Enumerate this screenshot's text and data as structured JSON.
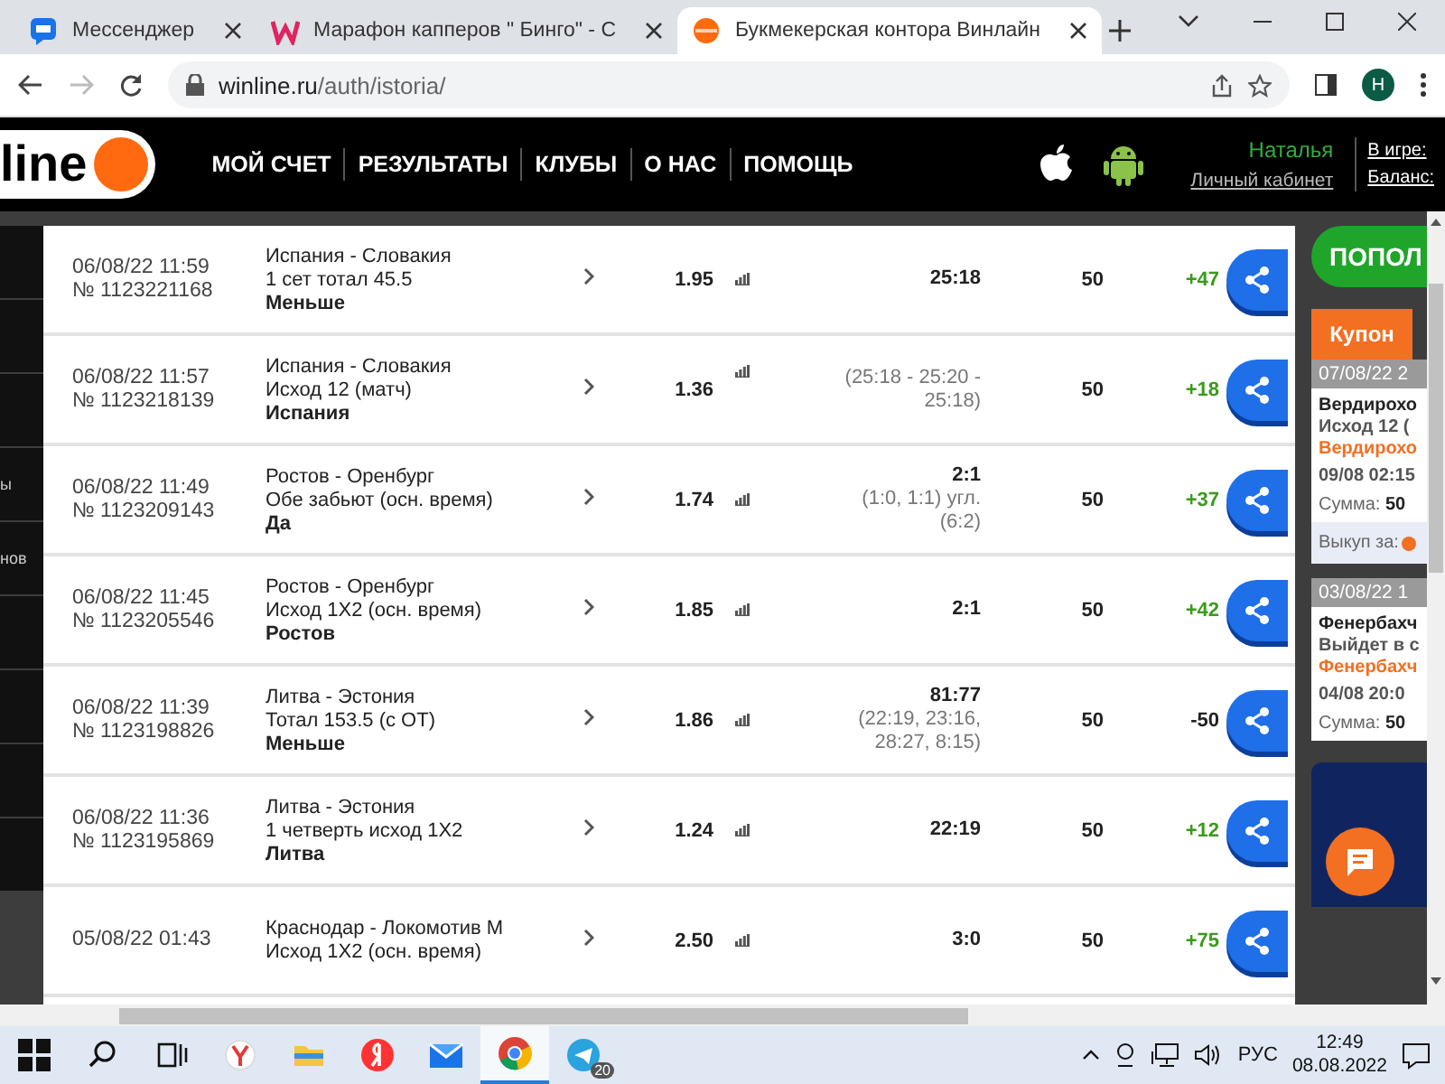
{
  "browser": {
    "tabs": [
      {
        "title": "Мессенджер",
        "selected": false
      },
      {
        "title": "Марафон капперов \" Бинго\" - С",
        "selected": false
      },
      {
        "title": "Букмекерская контора Винлайн",
        "selected": true
      }
    ],
    "url_host": "winline.ru",
    "url_path": "/auth/istoria/",
    "profile": "Н"
  },
  "header": {
    "logo": "line",
    "nav": [
      "МОЙ СЧЕТ",
      "РЕЗУЛЬТАТЫ",
      "КЛУБЫ",
      "О НАС",
      "ПОМОЩЬ"
    ],
    "user": "Наталья",
    "cabinet": "Личный кабинет",
    "in_game": "В игре:",
    "balance": "Баланс:"
  },
  "sidebar": {
    "items": [
      "ы",
      "нов"
    ]
  },
  "bets": [
    {
      "datetime": "06/08/22 11:59",
      "number": "№ 1123221168",
      "match": "Испания - Словакия",
      "market": "1 сет тотал 45.5",
      "pick": "Меньше",
      "odds": "1.95",
      "score": "25:18",
      "stake": "50",
      "result": "+47",
      "won": true
    },
    {
      "datetime": "06/08/22 11:57",
      "number": "№ 1123218139",
      "match": "Испания - Словакия",
      "market": "Исход 12 (матч)",
      "pick": "Испания",
      "odds": "1.36",
      "score_detail": "(25:18 - 25:20 - 25:18)",
      "stake": "50",
      "result": "+18",
      "won": true
    },
    {
      "datetime": "06/08/22 11:49",
      "number": "№ 1123209143",
      "match": "Ростов - Оренбург",
      "market": "Обе забьют (осн. время)",
      "pick": "Да",
      "odds": "1.74",
      "score": "2:1",
      "score_detail": "(1:0, 1:1) угл. (6:2)",
      "stake": "50",
      "result": "+37",
      "won": true
    },
    {
      "datetime": "06/08/22 11:45",
      "number": "№ 1123205546",
      "match": "Ростов - Оренбург",
      "market": "Исход 1Х2 (осн. время)",
      "pick": "Ростов",
      "odds": "1.85",
      "score": "2:1",
      "stake": "50",
      "result": "+42",
      "won": true
    },
    {
      "datetime": "06/08/22 11:39",
      "number": "№ 1123198826",
      "match": "Литва - Эстония",
      "market": "Тотал 153.5 (с ОТ)",
      "pick": "Меньше",
      "odds": "1.86",
      "score": "81:77",
      "score_detail": "(22:19, 23:16, 28:27, 8:15)",
      "stake": "50",
      "result": "-50",
      "won": false
    },
    {
      "datetime": "06/08/22 11:36",
      "number": "№ 1123195869",
      "match": "Литва - Эстония",
      "market": "1 четверть исход 1Х2",
      "pick": "Литва",
      "odds": "1.24",
      "score": "22:19",
      "stake": "50",
      "result": "+12",
      "won": true
    },
    {
      "datetime": "05/08/22 01:43",
      "match": "Краснодар - Локомотив М",
      "market": "Исход 1Х2 (осн. время)",
      "odds": "2.50",
      "score": "3:0",
      "stake": "50",
      "result": "+75",
      "won": true
    }
  ],
  "panel": {
    "deposit": "ПОПОЛ",
    "coupon_tab": "Купон",
    "coupons": [
      {
        "date": "07/08/22 2",
        "match": "Вердирохо",
        "market": "Исход 12 (",
        "pick": "Вердирохо",
        "time": "09/08 02:15",
        "sum_label": "Сумма:",
        "sum": "50",
        "cashout": "Выкуп за:"
      },
      {
        "date": "03/08/22 1",
        "match": "Фенербахч",
        "market": "Выйдет в с",
        "pick": "Фенербахч",
        "time": "04/08 20:0",
        "sum_label": "Сумма:",
        "sum": "50"
      }
    ]
  },
  "taskbar": {
    "apps": [
      {
        "active": false
      },
      {
        "active": false
      },
      {
        "active": false
      },
      {
        "active": false
      },
      {
        "active": true
      },
      {
        "active": false,
        "badge": "20"
      }
    ],
    "lang": "РУС",
    "time": "12:49",
    "date": "08.08.2022"
  }
}
